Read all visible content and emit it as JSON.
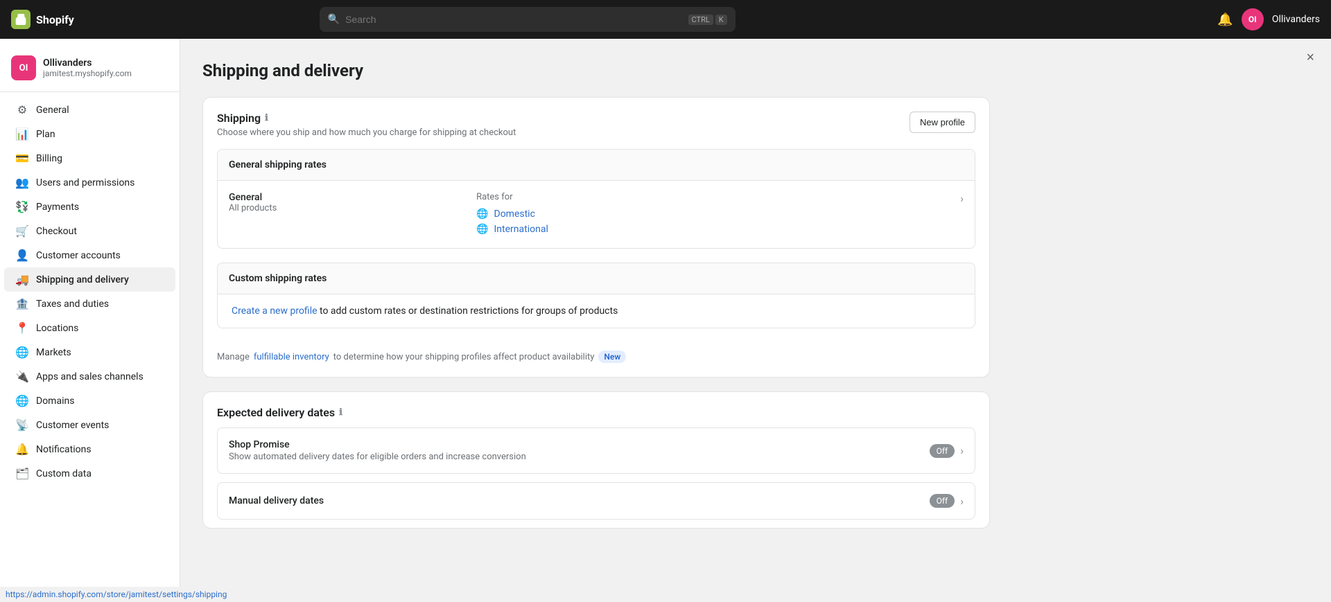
{
  "topnav": {
    "logo_text": "Shopify",
    "search_placeholder": "Search",
    "shortcut_ctrl": "CTRL",
    "shortcut_k": "K",
    "user_initials": "OI",
    "user_name": "Ollivanders"
  },
  "sidebar": {
    "store_name": "Ollivanders",
    "store_url": "jamitest.myshopify.com",
    "store_initials": "OI",
    "nav_items": [
      {
        "id": "general",
        "label": "General",
        "icon": "⚙"
      },
      {
        "id": "plan",
        "label": "Plan",
        "icon": "📊"
      },
      {
        "id": "billing",
        "label": "Billing",
        "icon": "💳"
      },
      {
        "id": "users-permissions",
        "label": "Users and permissions",
        "icon": "👥"
      },
      {
        "id": "payments",
        "label": "Payments",
        "icon": "💱"
      },
      {
        "id": "checkout",
        "label": "Checkout",
        "icon": "🛒"
      },
      {
        "id": "customer-accounts",
        "label": "Customer accounts",
        "icon": "👤"
      },
      {
        "id": "shipping-delivery",
        "label": "Shipping and delivery",
        "icon": "🚚"
      },
      {
        "id": "taxes-duties",
        "label": "Taxes and duties",
        "icon": "🏦"
      },
      {
        "id": "locations",
        "label": "Locations",
        "icon": "📍"
      },
      {
        "id": "markets",
        "label": "Markets",
        "icon": "🌐"
      },
      {
        "id": "apps-sales-channels",
        "label": "Apps and sales channels",
        "icon": "🔌"
      },
      {
        "id": "domains",
        "label": "Domains",
        "icon": "🌐"
      },
      {
        "id": "customer-events",
        "label": "Customer events",
        "icon": "📡"
      },
      {
        "id": "notifications",
        "label": "Notifications",
        "icon": "🔔"
      },
      {
        "id": "custom-data",
        "label": "Custom data",
        "icon": "🗂"
      }
    ]
  },
  "page": {
    "title": "Shipping and delivery",
    "shipping_card": {
      "section_title": "Shipping",
      "subtitle": "Choose where you ship and how much you charge for shipping at checkout",
      "new_profile_btn": "New profile",
      "general_rates_title": "General shipping rates",
      "general_label": "General",
      "general_sublabel": "All products",
      "rates_for_label": "Rates for",
      "rates": [
        {
          "label": "Domestic"
        },
        {
          "label": "International"
        }
      ],
      "custom_rates_title": "Custom shipping rates",
      "create_link_text": "Create a new profile",
      "custom_rates_desc": " to add custom rates or destination restrictions for groups of products",
      "manage_text": "Manage ",
      "fulfillable_link": "fulfillable inventory",
      "manage_text2": " to determine how your shipping profiles affect product availability",
      "badge_new": "New"
    },
    "delivery_card": {
      "title": "Expected delivery dates",
      "rows": [
        {
          "title": "Shop Promise",
          "desc": "Show automated delivery dates for eligible orders and increase conversion",
          "toggle": "Off"
        },
        {
          "title": "Manual delivery dates",
          "desc": "",
          "toggle": "Off"
        }
      ]
    }
  },
  "status_bar": {
    "url": "https://admin.shopify.com/store/jamitest/settings/shipping"
  },
  "close_btn": "×"
}
